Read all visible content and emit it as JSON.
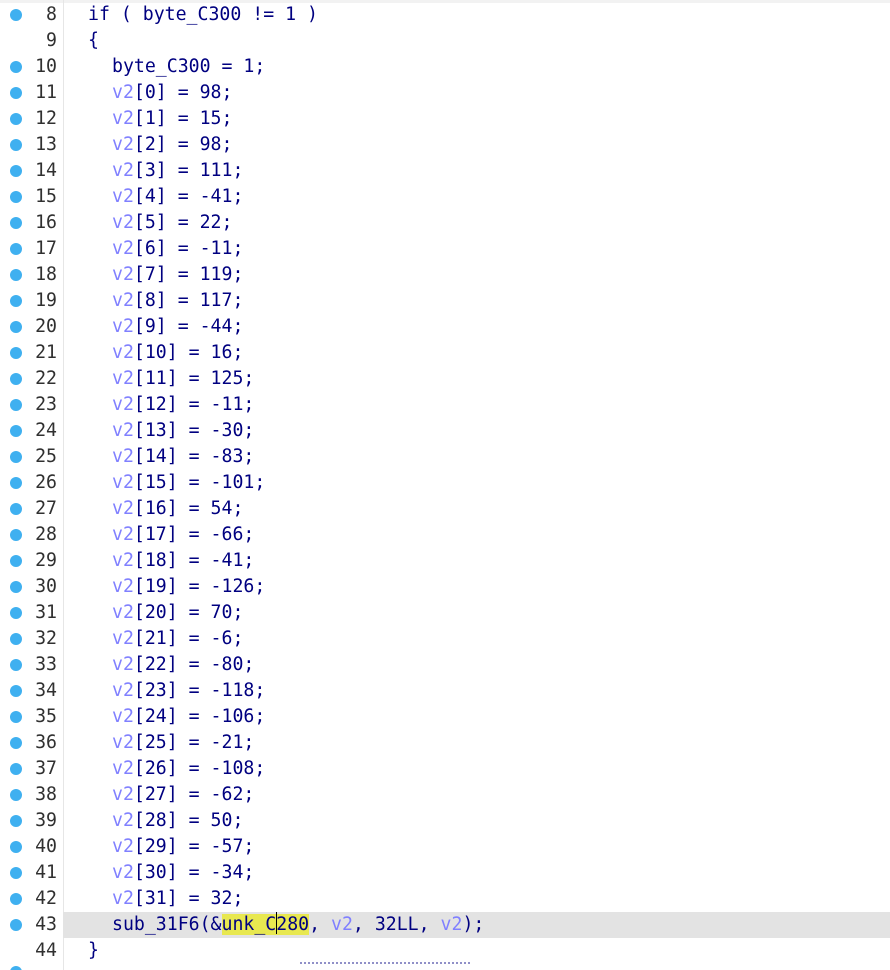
{
  "lines": [
    {
      "num": "8",
      "bp": true,
      "kind": "if",
      "text": "if ( byte_C300 != 1 )"
    },
    {
      "num": "9",
      "bp": false,
      "kind": "brace",
      "text": "{"
    },
    {
      "num": "10",
      "bp": true,
      "kind": "stmt",
      "text": "byte_C300 = 1;"
    },
    {
      "num": "11",
      "bp": true,
      "kind": "assign",
      "var": "v2",
      "rest": "[0] = 98;"
    },
    {
      "num": "12",
      "bp": true,
      "kind": "assign",
      "var": "v2",
      "rest": "[1] = 15;"
    },
    {
      "num": "13",
      "bp": true,
      "kind": "assign",
      "var": "v2",
      "rest": "[2] = 98;"
    },
    {
      "num": "14",
      "bp": true,
      "kind": "assign",
      "var": "v2",
      "rest": "[3] = 111;"
    },
    {
      "num": "15",
      "bp": true,
      "kind": "assign",
      "var": "v2",
      "rest": "[4] = -41;"
    },
    {
      "num": "16",
      "bp": true,
      "kind": "assign",
      "var": "v2",
      "rest": "[5] = 22;"
    },
    {
      "num": "17",
      "bp": true,
      "kind": "assign",
      "var": "v2",
      "rest": "[6] = -11;"
    },
    {
      "num": "18",
      "bp": true,
      "kind": "assign",
      "var": "v2",
      "rest": "[7] = 119;"
    },
    {
      "num": "19",
      "bp": true,
      "kind": "assign",
      "var": "v2",
      "rest": "[8] = 117;"
    },
    {
      "num": "20",
      "bp": true,
      "kind": "assign",
      "var": "v2",
      "rest": "[9] = -44;"
    },
    {
      "num": "21",
      "bp": true,
      "kind": "assign",
      "var": "v2",
      "rest": "[10] = 16;"
    },
    {
      "num": "22",
      "bp": true,
      "kind": "assign",
      "var": "v2",
      "rest": "[11] = 125;"
    },
    {
      "num": "23",
      "bp": true,
      "kind": "assign",
      "var": "v2",
      "rest": "[12] = -11;"
    },
    {
      "num": "24",
      "bp": true,
      "kind": "assign",
      "var": "v2",
      "rest": "[13] = -30;"
    },
    {
      "num": "25",
      "bp": true,
      "kind": "assign",
      "var": "v2",
      "rest": "[14] = -83;"
    },
    {
      "num": "26",
      "bp": true,
      "kind": "assign",
      "var": "v2",
      "rest": "[15] = -101;"
    },
    {
      "num": "27",
      "bp": true,
      "kind": "assign",
      "var": "v2",
      "rest": "[16] = 54;"
    },
    {
      "num": "28",
      "bp": true,
      "kind": "assign",
      "var": "v2",
      "rest": "[17] = -66;"
    },
    {
      "num": "29",
      "bp": true,
      "kind": "assign",
      "var": "v2",
      "rest": "[18] = -41;"
    },
    {
      "num": "30",
      "bp": true,
      "kind": "assign",
      "var": "v2",
      "rest": "[19] = -126;"
    },
    {
      "num": "31",
      "bp": true,
      "kind": "assign",
      "var": "v2",
      "rest": "[20] = 70;"
    },
    {
      "num": "32",
      "bp": true,
      "kind": "assign",
      "var": "v2",
      "rest": "[21] = -6;"
    },
    {
      "num": "33",
      "bp": true,
      "kind": "assign",
      "var": "v2",
      "rest": "[22] = -80;"
    },
    {
      "num": "34",
      "bp": true,
      "kind": "assign",
      "var": "v2",
      "rest": "[23] = -118;"
    },
    {
      "num": "35",
      "bp": true,
      "kind": "assign",
      "var": "v2",
      "rest": "[24] = -106;"
    },
    {
      "num": "36",
      "bp": true,
      "kind": "assign",
      "var": "v2",
      "rest": "[25] = -21;"
    },
    {
      "num": "37",
      "bp": true,
      "kind": "assign",
      "var": "v2",
      "rest": "[26] = -108;"
    },
    {
      "num": "38",
      "bp": true,
      "kind": "assign",
      "var": "v2",
      "rest": "[27] = -62;"
    },
    {
      "num": "39",
      "bp": true,
      "kind": "assign",
      "var": "v2",
      "rest": "[28] = 50;"
    },
    {
      "num": "40",
      "bp": true,
      "kind": "assign",
      "var": "v2",
      "rest": "[29] = -57;"
    },
    {
      "num": "41",
      "bp": true,
      "kind": "assign",
      "var": "v2",
      "rest": "[30] = -34;"
    },
    {
      "num": "42",
      "bp": true,
      "kind": "assign",
      "var": "v2",
      "rest": "[31] = 32;"
    },
    {
      "num": "43",
      "bp": true,
      "kind": "call",
      "current": true,
      "parts": {
        "fn": "sub_31F6(&",
        "hl_a": "unk_C",
        "hl_b": "280",
        "sep1": ", ",
        "arg2": "v2",
        "mid": ", 32LL, ",
        "arg4": "v2",
        "end": ");"
      }
    },
    {
      "num": "44",
      "bp": false,
      "kind": "brace",
      "text": "}"
    }
  ],
  "colors": {
    "code": "#000080",
    "variable": "#8080ff",
    "line_number": "#303030",
    "breakpoint": "#3fb0f0",
    "highlight": "#e8e850",
    "current_line": "#e3e3e3"
  }
}
